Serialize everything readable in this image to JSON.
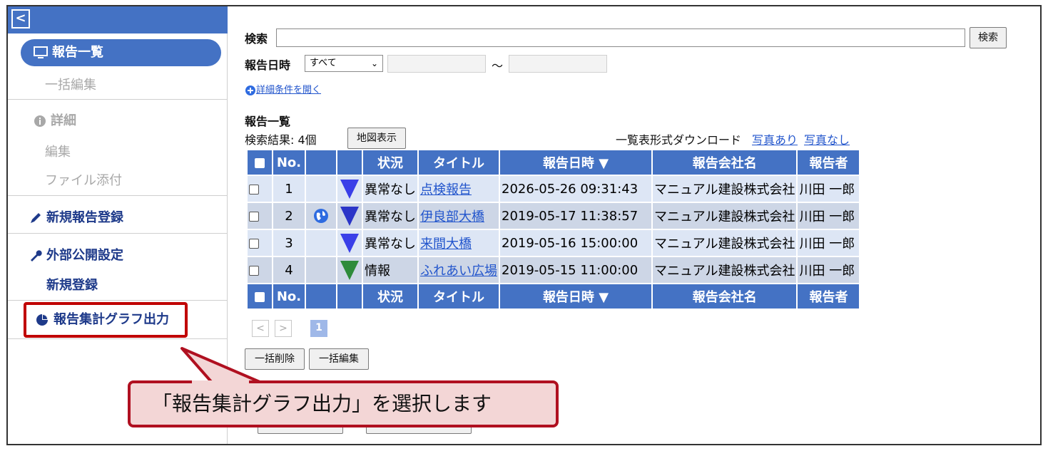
{
  "sidebar": {
    "back_icon": "chevron-left-icon",
    "report_list": "報告一覧",
    "bulk_edit": "一括編集",
    "detail": "詳細",
    "edit": "編集",
    "file_attach": "ファイル添付",
    "new_report": "新規報告登録",
    "public_settings": "外部公開設定",
    "new_register": "新規登録",
    "graph_output": "報告集計グラフ出力"
  },
  "search": {
    "label": "検索",
    "value": "",
    "button": "検索",
    "date_label": "報告日時",
    "date_option": "すべて",
    "tilde": "～",
    "detail_link": "詳細条件を開く"
  },
  "list": {
    "title": "報告一覧",
    "result_text": "検索結果: 4個",
    "map_button": "地図表示",
    "download_label": "一覧表形式ダウンロード",
    "with_photo": "写真あり",
    "without_photo": "写真なし",
    "columns": [
      "No.",
      "状況",
      "タイトル",
      "報告日時 ▼",
      "報告会社名",
      "報告者"
    ],
    "rows": [
      {
        "no": "1",
        "status": "異常なし",
        "title": "点検報告",
        "datetime": "2026-05-26 09:31:43",
        "company": "マニュアル建設株式会社",
        "reporter": "川田 一郎",
        "globe": false,
        "marker_color": "#3a3fe8"
      },
      {
        "no": "2",
        "status": "異常なし",
        "title": "伊良部大橋",
        "datetime": "2019-05-17 11:38:57",
        "company": "マニュアル建設株式会社",
        "reporter": "川田 一郎",
        "globe": true,
        "marker_color": "#2b35c8"
      },
      {
        "no": "3",
        "status": "異常なし",
        "title": "来間大橋",
        "datetime": "2019-05-16 15:00:00",
        "company": "マニュアル建設株式会社",
        "reporter": "川田 一郎",
        "globe": false,
        "marker_color": "#3a3fe8"
      },
      {
        "no": "4",
        "status": "情報",
        "title": "ふれあい広場",
        "datetime": "2019-05-15 11:00:00",
        "company": "マニュアル建設株式会社",
        "reporter": "川田 一郎",
        "globe": false,
        "marker_color": "#2e8b3a"
      }
    ]
  },
  "pagination": {
    "prev": "<",
    "next": ">",
    "current": "1"
  },
  "actions": {
    "bulk_delete": "一括削除",
    "bulk_edit": "一括編集"
  },
  "callout": {
    "text": "「報告集計グラフ出力」を選択します"
  }
}
